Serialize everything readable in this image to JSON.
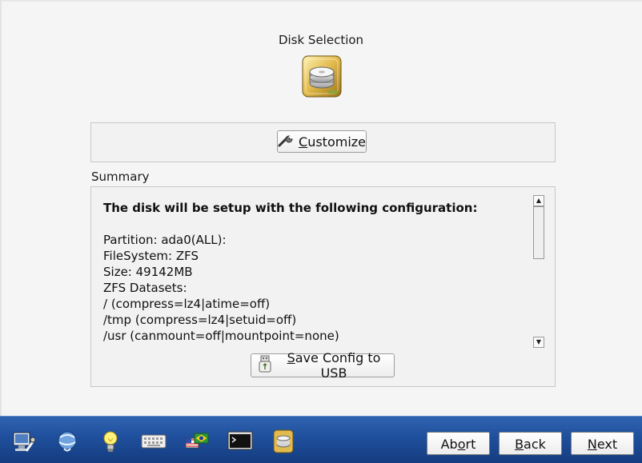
{
  "page": {
    "title": "Disk Selection"
  },
  "customize_button": {
    "mnemonic": "C",
    "rest": "ustomize",
    "icon": "wrench-icon"
  },
  "summary": {
    "label": "Summary",
    "heading": "The disk will be setup with the following configuration:",
    "lines": [
      "Partition: ada0(ALL):",
      "FileSystem: ZFS",
      "Size: 49142MB",
      "ZFS Datasets:",
      "/ (compress=lz4|atime=off)",
      "/tmp (compress=lz4|setuid=off)",
      "/usr (canmount=off|mountpoint=none)"
    ]
  },
  "save_button": {
    "mnemonic": "S",
    "rest": "ave Config to USB",
    "icon": "usb-drive-icon"
  },
  "taskbar": {
    "icons": [
      "system-tools-icon",
      "network-icon",
      "hints-icon",
      "keyboard-icon",
      "language-icon",
      "terminal-icon",
      "disk-icon"
    ]
  },
  "nav": {
    "abort_mnemonic": "o",
    "abort_pre": "Ab",
    "abort_post": "rt",
    "back_mnemonic": "B",
    "back_rest": "ack",
    "next_mnemonic": "N",
    "next_rest": "ext"
  },
  "colors": {
    "taskbar": "#1f4f9c",
    "panel_bg": "#f2f2f2",
    "page_bg": "#f5f5f5"
  }
}
